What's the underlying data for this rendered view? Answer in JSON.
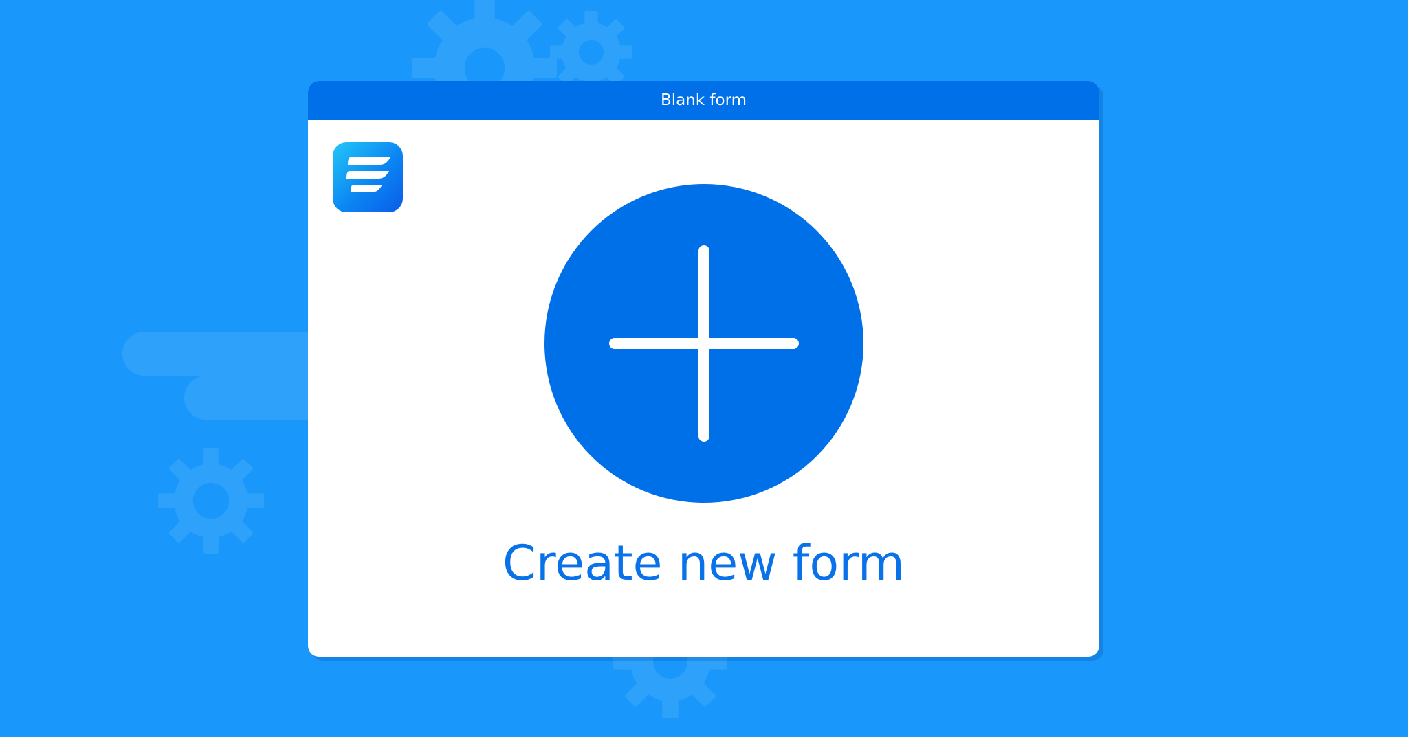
{
  "window": {
    "title": "Blank form"
  },
  "main": {
    "create_label": "Create new form",
    "add_icon": "plus-icon",
    "logo_icon": "app-logo-icon"
  },
  "background": {
    "decorations": [
      "gear-icon",
      "gear-icon",
      "gear-icon",
      "gear-icon"
    ]
  },
  "colors": {
    "background": "#1a97fa",
    "titlebar": "#0070e8",
    "button": "#0070e8",
    "label": "#0a72e8",
    "window": "#ffffff"
  }
}
